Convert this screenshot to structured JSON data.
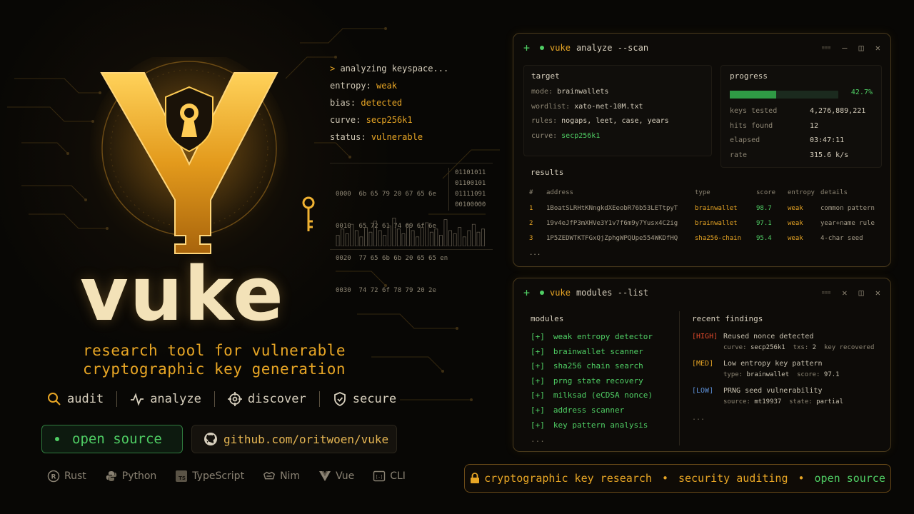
{
  "brand": {
    "name": "vuke",
    "tagline_line1": "research tool for vulnerable",
    "tagline_line2": "cryptographic key generation",
    "verbs": [
      "audit",
      "analyze",
      "discover",
      "secure"
    ],
    "open_source_label": "open source",
    "github_label": "github.com/oritwoen/vuke",
    "languages": [
      {
        "icon": "rust-icon",
        "label": "Rust"
      },
      {
        "icon": "python-icon",
        "label": "Python"
      },
      {
        "icon": "typescript-icon",
        "label": "TypeScript"
      },
      {
        "icon": "nim-icon",
        "label": "Nim"
      },
      {
        "icon": "vue-icon",
        "label": "Vue"
      },
      {
        "icon": "cli-icon",
        "label": "CLI"
      }
    ],
    "lang_glyphs": {
      "ts": "TS",
      "cli": "[-]"
    }
  },
  "analysis": {
    "command": "analyzing keyspace...",
    "lines": [
      {
        "key": "entropy:",
        "value": "weak"
      },
      {
        "key": "bias:",
        "value": "detected"
      },
      {
        "key": "curve:",
        "value": "secp256k1"
      },
      {
        "key": "status:",
        "value": "vulnerable"
      }
    ],
    "hex_rows": [
      "0000  6b 65 79 20 67 65 6e",
      "0010  65 72 61 74 69 6f 6e",
      "0020  77 65 6b 6b 20 65 65 en",
      "0030  74 72 6f 78 79 20 2e"
    ],
    "bin_rows": [
      "01101011",
      "01100101",
      "01111091",
      "00100000"
    ],
    "histogram": [
      0.35,
      0.55,
      0.4,
      0.7,
      0.5,
      0.3,
      0.6,
      0.45,
      0.8,
      0.5,
      0.35,
      0.65,
      0.9,
      0.55,
      0.4,
      0.7,
      0.5,
      0.3,
      0.6,
      0.75,
      0.45,
      0.55,
      0.35,
      0.85,
      0.5,
      0.4,
      0.6,
      0.3,
      0.5,
      0.7,
      0.45,
      0.55
    ]
  },
  "scan": {
    "title_cmd": "vuke",
    "title_rest": "analyze --scan",
    "window_tiny": "≡≡≡",
    "target": {
      "title": "target",
      "mode_label": "mode:",
      "mode": "brainwallets",
      "wordlist_label": "wordlist:",
      "wordlist": "xato-net-10M.txt",
      "rules_label": "rules:",
      "rules": "nogaps, leet, case, years",
      "curve_label": "curve:",
      "curve": "secp256k1"
    },
    "progress": {
      "title": "progress",
      "percent_label": "42.7%",
      "fraction": 0.427,
      "stats": [
        {
          "label": "keys tested",
          "value": "4,276,889,221"
        },
        {
          "label": "hits found",
          "value": "12"
        },
        {
          "label": "elapsed",
          "value": "03:47:11"
        },
        {
          "label": "rate",
          "value": "315.6 k/s"
        }
      ]
    },
    "results": {
      "title": "results",
      "headers": [
        "#",
        "address",
        "type",
        "score",
        "entropy",
        "details"
      ],
      "rows": [
        [
          "1",
          "1BoatSLRHtKNngkdXEeobR76b53LETtpyT",
          "brainwallet",
          "98.7",
          "weak",
          "common pattern"
        ],
        [
          "2",
          "19v4eJfP3mXHVe3Y1v7f6m9y7Yusx4C2ig",
          "brainwallet",
          "97.1",
          "weak",
          "year+name rule"
        ],
        [
          "3",
          "1P5ZEDWTKTFGxQjZphgWPQUpe554WKDfHQ",
          "sha256-chain",
          "95.4",
          "weak",
          "4-char seed"
        ]
      ],
      "more": "..."
    }
  },
  "modules_window": {
    "title_cmd": "vuke",
    "title_rest": "modules --list",
    "window_tiny": "≡≡≡",
    "modules_title": "modules",
    "bracket": "[+]",
    "modules": [
      "weak entropy detector",
      "brainwallet scanner",
      "sha256 chain search",
      "prng state recovery",
      "milksad (eCDSA nonce)",
      "address scanner",
      "key pattern analysis"
    ],
    "more": "...",
    "findings_title": "recent findings",
    "findings": [
      {
        "level": "[HIGH]",
        "cls": "high",
        "title": "Reused nonce detected",
        "detail_a_label": "curve:",
        "detail_a": "secp256k1",
        "detail_b_label": "txs:",
        "detail_b": "2",
        "detail_c": "key recovered"
      },
      {
        "level": "[MED]",
        "cls": "med",
        "title": "Low entropy key pattern",
        "detail_a_label": "type:",
        "detail_a": "brainwallet",
        "detail_b_label": "score:",
        "detail_b": "97.1",
        "detail_c": ""
      },
      {
        "level": "[LOW]",
        "cls": "low",
        "title": "PRNG seed vulnerability",
        "detail_a_label": "source:",
        "detail_a": "mt19937",
        "detail_b_label": "state:",
        "detail_b": "partial",
        "detail_c": ""
      }
    ],
    "findings_more": "..."
  },
  "ribbon": {
    "item1": "cryptographic key research",
    "item2": "security auditing",
    "item3": "open source",
    "bullet": "•"
  },
  "colors": {
    "accent": "#e8a625",
    "green": "#4fce64",
    "high": "#e24a2c",
    "low": "#5c8fd6",
    "bg": "#080705"
  }
}
